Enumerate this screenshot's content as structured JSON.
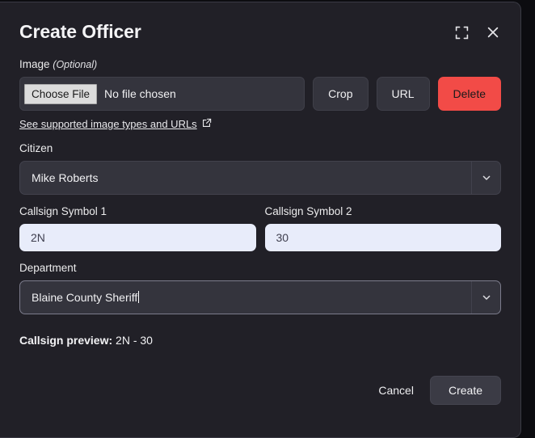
{
  "modal": {
    "title": "Create Officer",
    "expand_icon": "expand-icon",
    "close_icon": "close-icon"
  },
  "image": {
    "label": "Image",
    "optional": "(Optional)",
    "choose_file_label": "Choose File",
    "file_name": "No file chosen",
    "crop_label": "Crop",
    "url_label": "URL",
    "delete_label": "Delete",
    "support_link_label": "See supported image types and URLs",
    "support_link_icon": "external-link-icon"
  },
  "citizen": {
    "label": "Citizen",
    "value": "Mike Roberts",
    "arrow_icon": "chevron-down-icon"
  },
  "callsign_symbol_1": {
    "label": "Callsign Symbol 1",
    "value": "2N"
  },
  "callsign_symbol_2": {
    "label": "Callsign Symbol 2",
    "value": "30"
  },
  "department": {
    "label": "Department",
    "value": "Blaine County Sheriff",
    "arrow_icon": "chevron-down-icon"
  },
  "preview": {
    "label": "Callsign preview:",
    "value": "2N - 30"
  },
  "footer": {
    "cancel_label": "Cancel",
    "create_label": "Create"
  },
  "colors": {
    "modal_bg": "#212027",
    "backdrop": "#0c0c10",
    "danger": "#f24b47",
    "input_light_bg": "#e8ecfa",
    "control_bg": "#34343d"
  }
}
